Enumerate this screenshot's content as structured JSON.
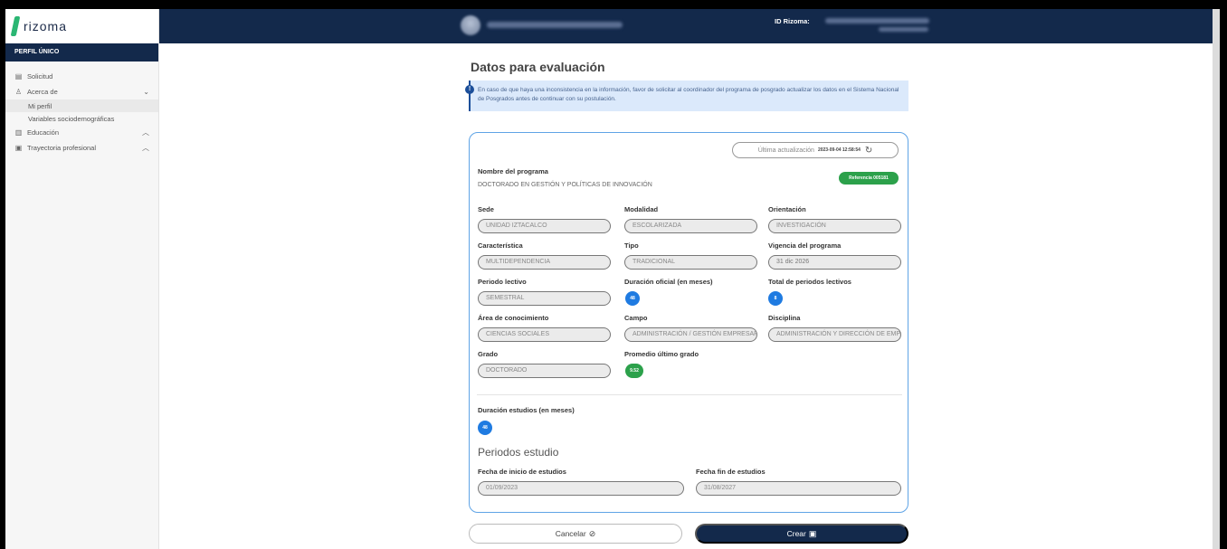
{
  "sidebar": {
    "logo": "rizoma",
    "header": "PERFIL ÚNICO",
    "items": [
      {
        "label": "Solicitud",
        "icon": "document-icon"
      },
      {
        "label": "Acerca de",
        "icon": "user-icon",
        "chevron": "⌄"
      },
      {
        "label": "Educación",
        "icon": "book-icon",
        "chevron": "^"
      },
      {
        "label": "Trayectoria profesional",
        "icon": "briefcase-icon",
        "chevron": "^"
      }
    ],
    "subitems": [
      {
        "label": "Mi perfil"
      },
      {
        "label": "Variables sociodemográficas"
      }
    ]
  },
  "topbar": {
    "id_label": "ID Rizoma:"
  },
  "page": {
    "title": "Datos para evaluación",
    "info": "En caso de que haya una inconsistencia en la información, favor de solicitar al coordinador del programa de posgrado actualizar los datos en el Sistema Nacional de Posgrados antes de continuar con su postulación."
  },
  "card": {
    "updated_label": "Última actualización",
    "updated_value": "2023-09-04 12:58:54",
    "program_label": "Nombre del programa",
    "program_value": "DOCTORADO EN GESTIÓN Y POLÍTICAS DE INNOVACIÓN",
    "reference_badge": "Referencia 005181",
    "fields": {
      "sede": {
        "label": "Sede",
        "value": "UNIDAD IZTACALCO"
      },
      "modalidad": {
        "label": "Modalidad",
        "value": "ESCOLARIZADA"
      },
      "orientacion": {
        "label": "Orientación",
        "value": "INVESTIGACIÓN"
      },
      "caracteristica": {
        "label": "Característica",
        "value": "MULTIDEPENDENCIA"
      },
      "tipo": {
        "label": "Tipo",
        "value": "TRADICIONAL"
      },
      "vigencia": {
        "label": "Vigencia del programa",
        "value": "31 dic 2026"
      },
      "periodo": {
        "label": "Periodo lectivo",
        "value": "SEMESTRAL"
      },
      "duracion_oficial": {
        "label": "Duración oficial (en meses)",
        "value": "48"
      },
      "total_periodos": {
        "label": "Total de periodos lectivos",
        "value": "8"
      },
      "area": {
        "label": "Área de conocimiento",
        "value": "CIENCIAS SOCIALES"
      },
      "campo": {
        "label": "Campo",
        "value": "ADMINISTRACIÓN / GESTIÓN EMPRESARIAL"
      },
      "disciplina": {
        "label": "Disciplina",
        "value": "ADMINISTRACIÓN Y DIRECCIÓN DE EMPRESAS"
      },
      "grado": {
        "label": "Grado",
        "value": "DOCTORADO"
      },
      "promedio": {
        "label": "Promedio último grado",
        "value": "9.52"
      },
      "duracion_estudios": {
        "label": "Duración estudios (en meses)",
        "value": "48"
      },
      "fecha_inicio": {
        "label": "Fecha de inicio de estudios",
        "value": "01/09/2023"
      },
      "fecha_fin": {
        "label": "Fecha fin de estudios",
        "value": "31/08/2027"
      }
    },
    "periods_title": "Periodos estudio"
  },
  "actions": {
    "cancel": "Cancelar",
    "create": "Crear"
  },
  "colors": {
    "navy": "#13294b",
    "accent_blue": "#1f7be1",
    "green": "#2ca14b",
    "card_border": "#5fa4e6"
  }
}
